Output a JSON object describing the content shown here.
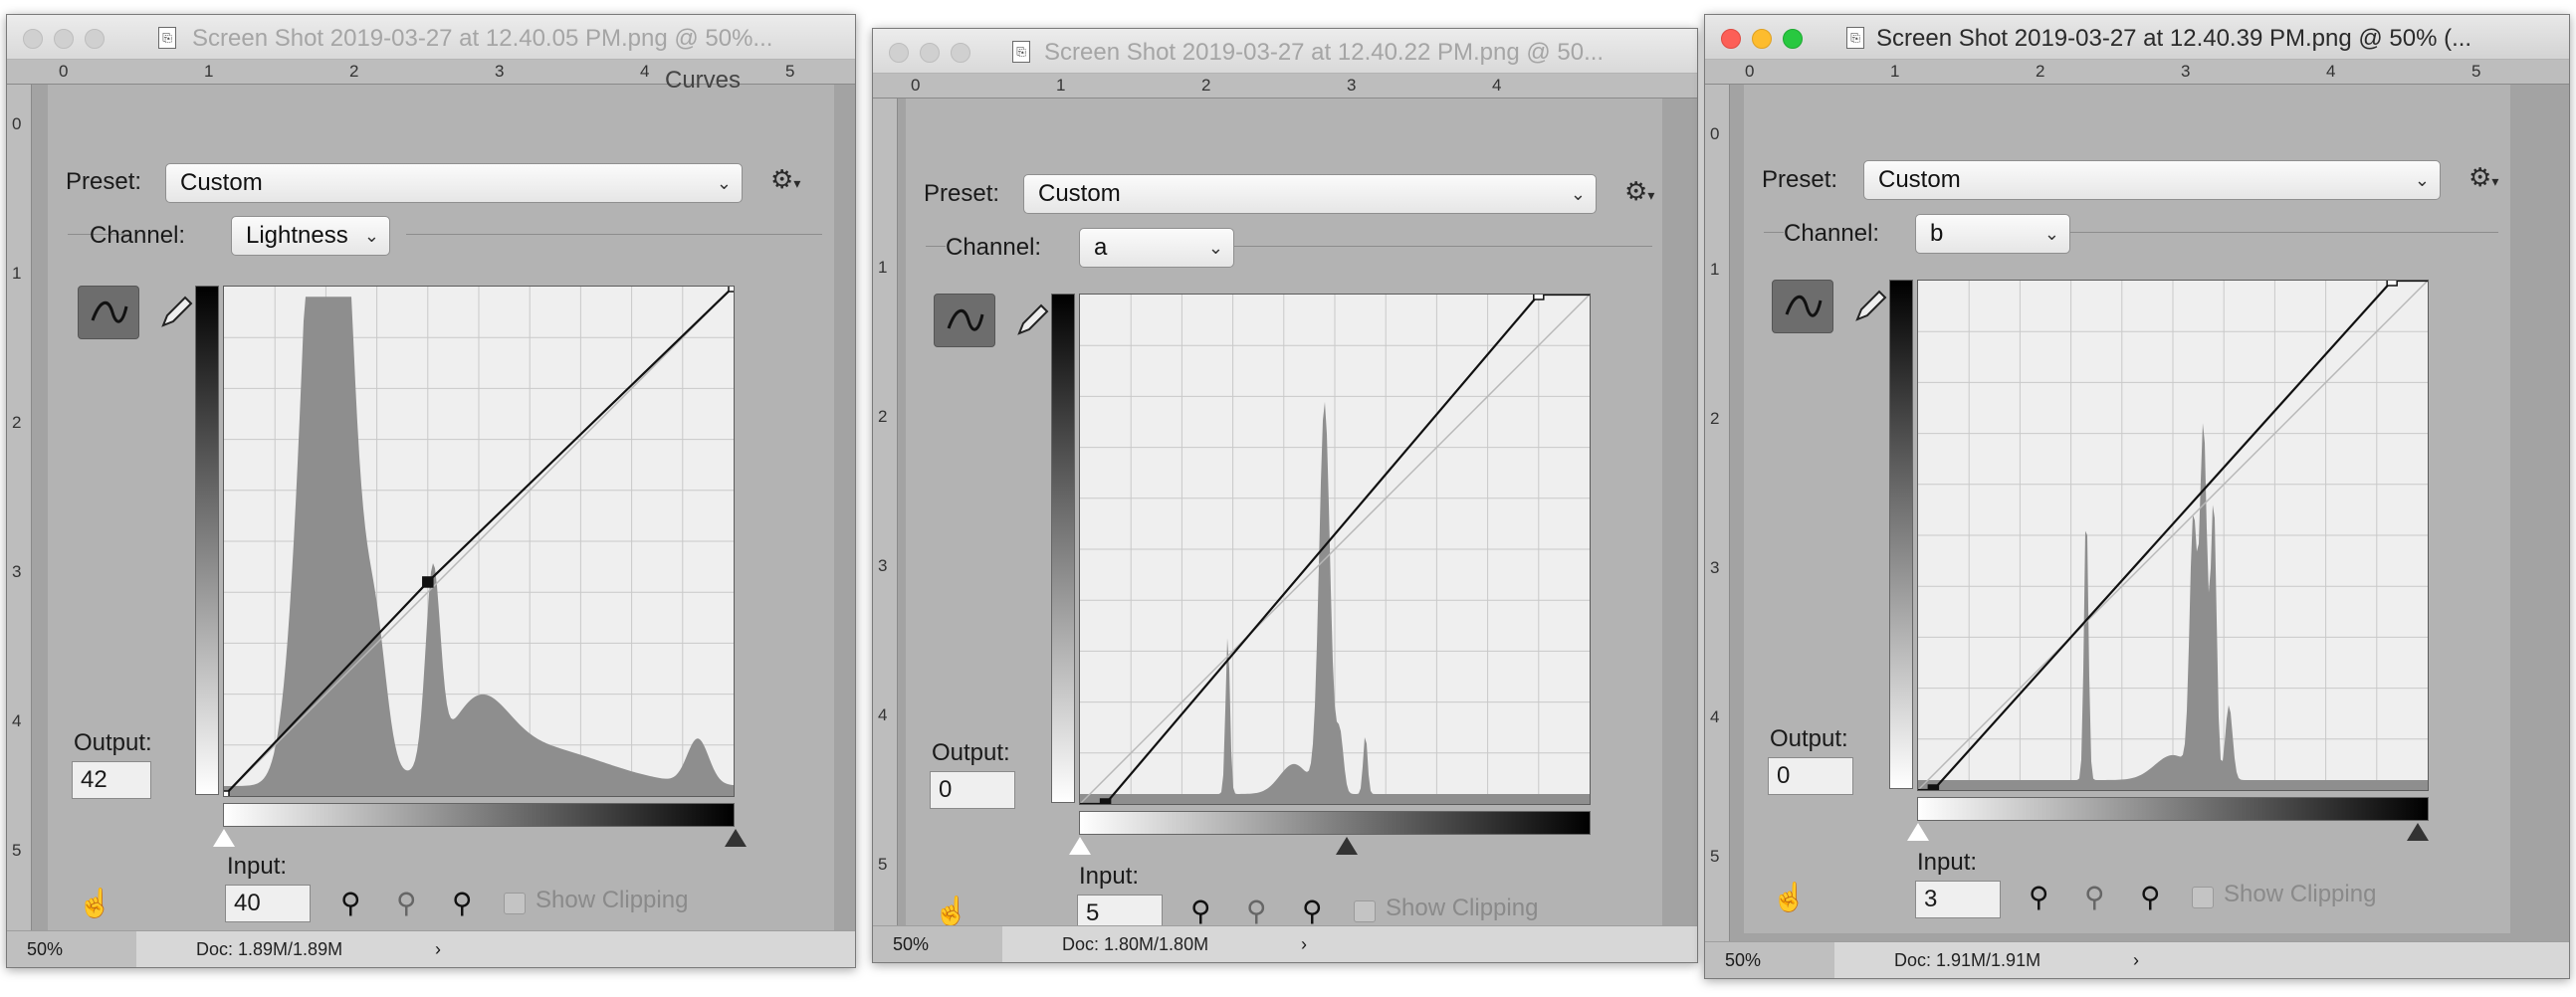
{
  "windows": [
    {
      "title": "Screen Shot 2019-03-27 at 12.40.05 PM.png @ 50%...",
      "active": false,
      "ruler_top": [
        "0",
        "1",
        "2",
        "3",
        "4",
        "5"
      ],
      "ruler_left": [
        "0",
        "1",
        "2",
        "3",
        "4",
        "5"
      ],
      "panel_title": "Curves",
      "preset_label": "Preset:",
      "preset_value": "Custom",
      "channel_label": "Channel:",
      "channel_value": "Lightness",
      "output_label": "Output:",
      "output_value": "42",
      "input_label": "Input:",
      "input_value": "40",
      "show_clipping": "Show Clipping",
      "zoom": "50%",
      "doc_info": "Doc: 1.89M/1.89M",
      "status_arrow": "›",
      "curve": {
        "points": [
          [
            0,
            0
          ],
          [
            40,
            42
          ],
          [
            100,
            100
          ]
        ],
        "selected": [
          40,
          42
        ]
      }
    },
    {
      "title": "Screen Shot 2019-03-27 at 12.40.22 PM.png @ 50...",
      "active": false,
      "ruler_top": [
        "0",
        "1",
        "2",
        "3",
        "4"
      ],
      "ruler_left": [
        "1",
        "2",
        "3",
        "4",
        "5"
      ],
      "panel_title": "",
      "preset_label": "Preset:",
      "preset_value": "Custom",
      "channel_label": "Channel:",
      "channel_value": "a",
      "output_label": "Output:",
      "output_value": "0",
      "input_label": "Input:",
      "input_value": "5",
      "show_clipping": "Show Clipping",
      "zoom": "50%",
      "doc_info": "Doc: 1.80M/1.80M",
      "status_arrow": "›",
      "curve": {
        "points": [
          [
            5,
            0
          ],
          [
            90,
            100
          ]
        ],
        "selected": [
          5,
          0
        ]
      }
    },
    {
      "title": "Screen Shot 2019-03-27 at 12.40.39 PM.png @ 50% (...",
      "active": true,
      "ruler_top": [
        "0",
        "1",
        "2",
        "3",
        "4",
        "5"
      ],
      "ruler_left": [
        "0",
        "1",
        "2",
        "3",
        "4",
        "5"
      ],
      "panel_title": "",
      "preset_label": "Preset:",
      "preset_value": "Custom",
      "channel_label": "Channel:",
      "channel_value": "b",
      "output_label": "Output:",
      "output_value": "0",
      "input_label": "Input:",
      "input_value": "3",
      "show_clipping": "Show Clipping",
      "zoom": "50%",
      "doc_info": "Doc: 1.91M/1.91M",
      "status_arrow": "›",
      "curve": {
        "points": [
          [
            3,
            0
          ],
          [
            93,
            100
          ]
        ],
        "selected": [
          3,
          0
        ]
      }
    }
  ]
}
